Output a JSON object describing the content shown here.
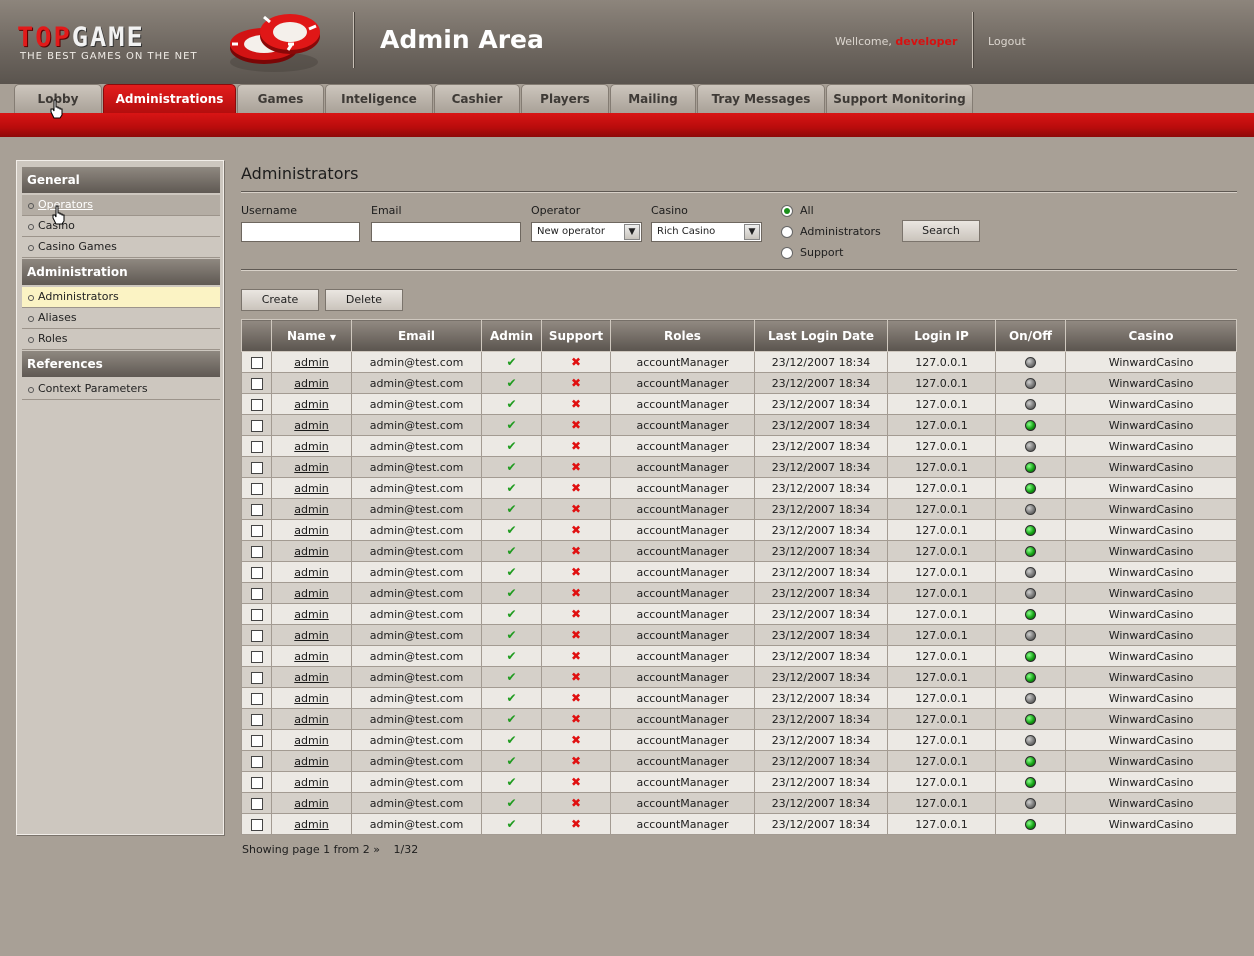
{
  "header": {
    "logo_top": "TOP",
    "logo_game": "GAME",
    "tagline": "THE BEST GAMES ON THE NET",
    "title": "Admin Area",
    "welcome_prefix": "Wellcome,",
    "username": "developer",
    "logout_label": "Logout"
  },
  "tabs": [
    {
      "label": "Lobby"
    },
    {
      "label": "Administrations"
    },
    {
      "label": "Games"
    },
    {
      "label": "Inteligence"
    },
    {
      "label": "Cashier"
    },
    {
      "label": "Players"
    },
    {
      "label": "Mailing"
    },
    {
      "label": "Tray Messages"
    },
    {
      "label": "Support Monitoring"
    }
  ],
  "active_tab": "Administrations",
  "sidebar": {
    "general_title": "General",
    "general_items": [
      "Operators",
      "Casino",
      "Casino Games"
    ],
    "administration_title": "Administration",
    "administration_items": [
      "Administrators",
      "Aliases",
      "Roles"
    ],
    "references_title": "References",
    "references_items": [
      "Context Parameters"
    ]
  },
  "page": {
    "title": "Administrators"
  },
  "filters": {
    "username_label": "Username",
    "email_label": "Email",
    "operator_label": "Operator",
    "operator_value": "New operator",
    "casino_label": "Casino",
    "casino_value": "Rich Casino",
    "radio_options": [
      "All",
      "Administrators",
      "Support"
    ],
    "radio_selected": "All",
    "search_label": "Search"
  },
  "actions": {
    "create_label": "Create",
    "delete_label": "Delete"
  },
  "table": {
    "columns": [
      "",
      "Name",
      "Email",
      "Admin",
      "Support",
      "Roles",
      "Last Login Date",
      "Login IP",
      "On/Off",
      "Casino"
    ],
    "rows": [
      {
        "name": "admin",
        "email": "admin@test.com",
        "admin": true,
        "support": false,
        "roles": "accountManager",
        "last_login": "23/12/2007 18:34",
        "ip": "127.0.0.1",
        "online": false,
        "casino": "WinwardCasino"
      },
      {
        "name": "admin",
        "email": "admin@test.com",
        "admin": true,
        "support": false,
        "roles": "accountManager",
        "last_login": "23/12/2007 18:34",
        "ip": "127.0.0.1",
        "online": false,
        "casino": "WinwardCasino"
      },
      {
        "name": "admin",
        "email": "admin@test.com",
        "admin": true,
        "support": false,
        "roles": "accountManager",
        "last_login": "23/12/2007 18:34",
        "ip": "127.0.0.1",
        "online": false,
        "casino": "WinwardCasino"
      },
      {
        "name": "admin",
        "email": "admin@test.com",
        "admin": true,
        "support": false,
        "roles": "accountManager",
        "last_login": "23/12/2007 18:34",
        "ip": "127.0.0.1",
        "online": true,
        "casino": "WinwardCasino"
      },
      {
        "name": "admin",
        "email": "admin@test.com",
        "admin": true,
        "support": false,
        "roles": "accountManager",
        "last_login": "23/12/2007 18:34",
        "ip": "127.0.0.1",
        "online": false,
        "casino": "WinwardCasino"
      },
      {
        "name": "admin",
        "email": "admin@test.com",
        "admin": true,
        "support": false,
        "roles": "accountManager",
        "last_login": "23/12/2007 18:34",
        "ip": "127.0.0.1",
        "online": true,
        "casino": "WinwardCasino"
      },
      {
        "name": "admin",
        "email": "admin@test.com",
        "admin": true,
        "support": false,
        "roles": "accountManager",
        "last_login": "23/12/2007 18:34",
        "ip": "127.0.0.1",
        "online": true,
        "casino": "WinwardCasino"
      },
      {
        "name": "admin",
        "email": "admin@test.com",
        "admin": true,
        "support": false,
        "roles": "accountManager",
        "last_login": "23/12/2007 18:34",
        "ip": "127.0.0.1",
        "online": false,
        "casino": "WinwardCasino"
      },
      {
        "name": "admin",
        "email": "admin@test.com",
        "admin": true,
        "support": false,
        "roles": "accountManager",
        "last_login": "23/12/2007 18:34",
        "ip": "127.0.0.1",
        "online": true,
        "casino": "WinwardCasino"
      },
      {
        "name": "admin",
        "email": "admin@test.com",
        "admin": true,
        "support": false,
        "roles": "accountManager",
        "last_login": "23/12/2007 18:34",
        "ip": "127.0.0.1",
        "online": true,
        "casino": "WinwardCasino"
      },
      {
        "name": "admin",
        "email": "admin@test.com",
        "admin": true,
        "support": false,
        "roles": "accountManager",
        "last_login": "23/12/2007 18:34",
        "ip": "127.0.0.1",
        "online": false,
        "casino": "WinwardCasino"
      },
      {
        "name": "admin",
        "email": "admin@test.com",
        "admin": true,
        "support": false,
        "roles": "accountManager",
        "last_login": "23/12/2007 18:34",
        "ip": "127.0.0.1",
        "online": false,
        "casino": "WinwardCasino"
      },
      {
        "name": "admin",
        "email": "admin@test.com",
        "admin": true,
        "support": false,
        "roles": "accountManager",
        "last_login": "23/12/2007 18:34",
        "ip": "127.0.0.1",
        "online": true,
        "casino": "WinwardCasino"
      },
      {
        "name": "admin",
        "email": "admin@test.com",
        "admin": true,
        "support": false,
        "roles": "accountManager",
        "last_login": "23/12/2007 18:34",
        "ip": "127.0.0.1",
        "online": false,
        "casino": "WinwardCasino"
      },
      {
        "name": "admin",
        "email": "admin@test.com",
        "admin": true,
        "support": false,
        "roles": "accountManager",
        "last_login": "23/12/2007 18:34",
        "ip": "127.0.0.1",
        "online": true,
        "casino": "WinwardCasino"
      },
      {
        "name": "admin",
        "email": "admin@test.com",
        "admin": true,
        "support": false,
        "roles": "accountManager",
        "last_login": "23/12/2007 18:34",
        "ip": "127.0.0.1",
        "online": true,
        "casino": "WinwardCasino"
      },
      {
        "name": "admin",
        "email": "admin@test.com",
        "admin": true,
        "support": false,
        "roles": "accountManager",
        "last_login": "23/12/2007 18:34",
        "ip": "127.0.0.1",
        "online": false,
        "casino": "WinwardCasino"
      },
      {
        "name": "admin",
        "email": "admin@test.com",
        "admin": true,
        "support": false,
        "roles": "accountManager",
        "last_login": "23/12/2007 18:34",
        "ip": "127.0.0.1",
        "online": true,
        "casino": "WinwardCasino"
      },
      {
        "name": "admin",
        "email": "admin@test.com",
        "admin": true,
        "support": false,
        "roles": "accountManager",
        "last_login": "23/12/2007 18:34",
        "ip": "127.0.0.1",
        "online": false,
        "casino": "WinwardCasino"
      },
      {
        "name": "admin",
        "email": "admin@test.com",
        "admin": true,
        "support": false,
        "roles": "accountManager",
        "last_login": "23/12/2007 18:34",
        "ip": "127.0.0.1",
        "online": true,
        "casino": "WinwardCasino"
      },
      {
        "name": "admin",
        "email": "admin@test.com",
        "admin": true,
        "support": false,
        "roles": "accountManager",
        "last_login": "23/12/2007 18:34",
        "ip": "127.0.0.1",
        "online": true,
        "casino": "WinwardCasino"
      },
      {
        "name": "admin",
        "email": "admin@test.com",
        "admin": true,
        "support": false,
        "roles": "accountManager",
        "last_login": "23/12/2007 18:34",
        "ip": "127.0.0.1",
        "online": false,
        "casino": "WinwardCasino"
      },
      {
        "name": "admin",
        "email": "admin@test.com",
        "admin": true,
        "support": false,
        "roles": "accountManager",
        "last_login": "23/12/2007 18:34",
        "ip": "127.0.0.1",
        "online": true,
        "casino": "WinwardCasino"
      }
    ]
  },
  "pager": {
    "showing": "Showing page 1 from 2 »",
    "records": "1/32"
  },
  "colors": {
    "brand_red": "#d81515",
    "online_green": "#15a315",
    "offline_gray": "#7a7a7a",
    "selected_item": "#fbf3c4"
  },
  "icons": {
    "admin_true": "green-check-icon",
    "support_false": "red-cross-icon",
    "online": "green-dot-icon",
    "offline": "gray-dot-icon"
  }
}
